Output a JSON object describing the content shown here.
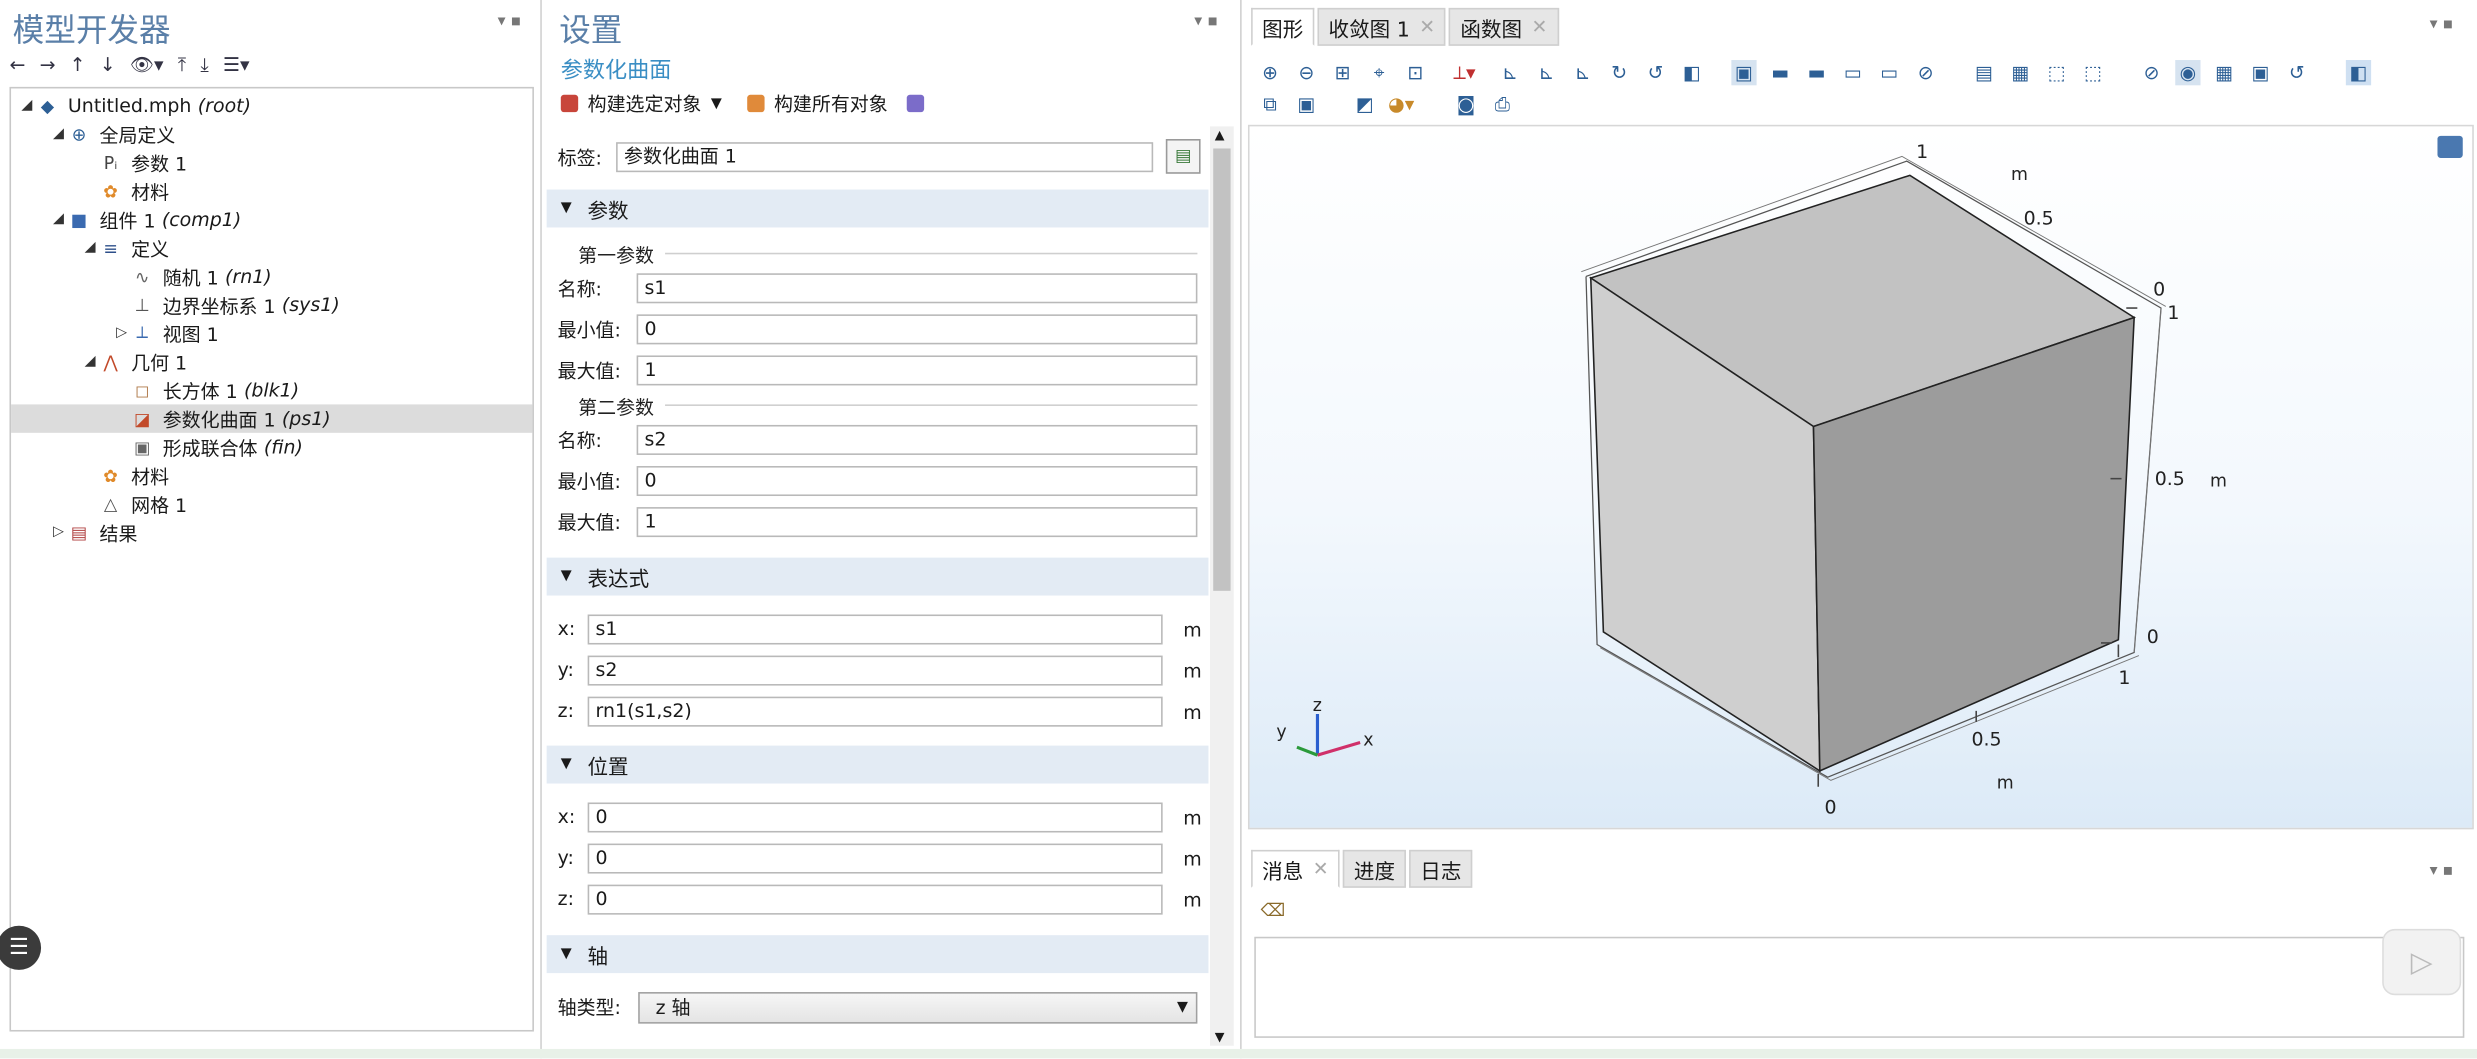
{
  "left_pane": {
    "title": "模型开发器",
    "toolbar_icons": [
      "back-arrow-icon",
      "forward-arrow-icon",
      "move-up-icon",
      "move-down-icon",
      "show-icon",
      "dropdown-icon",
      "expand-all-icon",
      "collapse-all-icon",
      "list-icon",
      "dropdown-icon"
    ],
    "tree": [
      {
        "label": "Untitled.mph",
        "tag": "(root)",
        "depth": 0,
        "twisty": "◢",
        "icon": "file-icon"
      },
      {
        "label": "全局定义",
        "tag": "",
        "depth": 1,
        "twisty": "◢",
        "icon": "globe-icon"
      },
      {
        "label": "参数 1",
        "tag": "",
        "depth": 2,
        "twisty": "",
        "icon": "parameter-icon"
      },
      {
        "label": "材料",
        "tag": "",
        "depth": 2,
        "twisty": "",
        "icon": "material-icon"
      },
      {
        "label": "组件 1",
        "tag": "(comp1)",
        "depth": 1,
        "twisty": "◢",
        "icon": "component-icon"
      },
      {
        "label": "定义",
        "tag": "",
        "depth": 2,
        "twisty": "◢",
        "icon": "definitions-icon"
      },
      {
        "label": "随机 1",
        "tag": "(rn1)",
        "depth": 3,
        "twisty": "",
        "icon": "random-function-icon"
      },
      {
        "label": "边界坐标系 1",
        "tag": "(sys1)",
        "depth": 3,
        "twisty": "",
        "icon": "coordinate-system-icon"
      },
      {
        "label": "视图 1",
        "tag": "",
        "depth": 3,
        "twisty": "▷",
        "icon": "view-icon"
      },
      {
        "label": "几何 1",
        "tag": "",
        "depth": 2,
        "twisty": "◢",
        "icon": "geometry-icon"
      },
      {
        "label": "长方体 1",
        "tag": "(blk1)",
        "depth": 3,
        "twisty": "",
        "icon": "block-icon"
      },
      {
        "label": "参数化曲面 1",
        "tag": "(ps1)",
        "depth": 3,
        "twisty": "",
        "icon": "parametric-surface-icon",
        "selected": true
      },
      {
        "label": "形成联合体",
        "tag": "(fin)",
        "depth": 3,
        "twisty": "",
        "icon": "form-union-icon"
      },
      {
        "label": "材料",
        "tag": "",
        "depth": 2,
        "twisty": "",
        "icon": "material-icon"
      },
      {
        "label": "网格 1",
        "tag": "",
        "depth": 2,
        "twisty": "",
        "icon": "mesh-icon"
      },
      {
        "label": "结果",
        "tag": "",
        "depth": 1,
        "twisty": "▷",
        "icon": "results-icon"
      }
    ]
  },
  "settings": {
    "title": "设置",
    "subtitle": "参数化曲面",
    "build_selected": "构建选定对象",
    "build_all": "构建所有对象",
    "label_caption": "标签:",
    "label_value": "参数化曲面 1",
    "sec_params": "参数",
    "first_param": "第一参数",
    "second_param": "第二参数",
    "name_caption": "名称:",
    "min_caption": "最小值:",
    "max_caption": "最大值:",
    "p1_name": "s1",
    "p1_min": "0",
    "p1_max": "1",
    "p2_name": "s2",
    "p2_min": "0",
    "p2_max": "1",
    "sec_expr": "表达式",
    "x_caption": "x:",
    "y_caption": "y:",
    "z_caption": "z:",
    "expr_x": "s1",
    "expr_y": "s2",
    "expr_z": "rn1(s1,s2)",
    "unit": "m",
    "sec_pos": "位置",
    "pos_x": "0",
    "pos_y": "0",
    "pos_z": "0",
    "sec_axis": "轴",
    "axis_type_caption": "轴类型:",
    "axis_type_value": "z 轴"
  },
  "graphics": {
    "tabs": [
      {
        "label": "图形",
        "close": false
      },
      {
        "label": "收敛图 1",
        "close": true
      },
      {
        "label": "函数图",
        "close": true
      }
    ],
    "axis_labels": {
      "top_1": "1",
      "top_m": "m",
      "top_05": "0.5",
      "top_0": "0",
      "right_1": "1",
      "right_05": "0.5",
      "right_m": "m",
      "right_0": "0",
      "bot_1": "1",
      "bot_05": "0.5",
      "bot_m": "m",
      "bot_0": "0"
    },
    "triad": {
      "x": "x",
      "y": "y",
      "z": "z"
    }
  },
  "messages": {
    "tabs": [
      {
        "label": "消息",
        "close": true
      },
      {
        "label": "进度",
        "close": false
      },
      {
        "label": "日志",
        "close": false
      }
    ]
  }
}
